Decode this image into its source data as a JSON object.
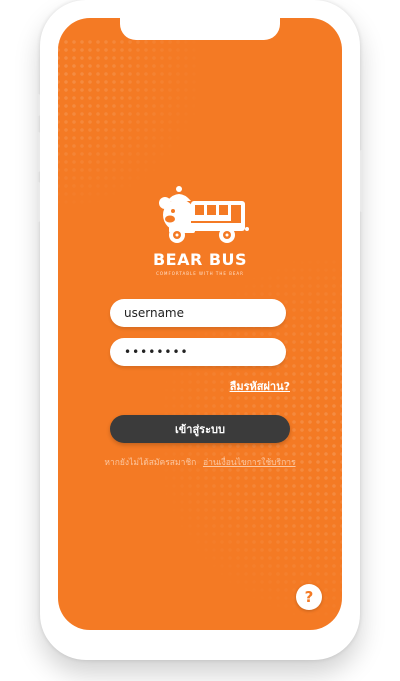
{
  "brand": {
    "name": "BEAR BUS",
    "tagline": "COMFORTABLE WITH THE BEAR"
  },
  "login": {
    "username_value": "username",
    "password_value": "••••••••",
    "forgot_label": "ลืมรหัสผ่าน?",
    "submit_label": "เข้าสู่ระบบ"
  },
  "register": {
    "prompt": "หากยังไม่ได้สมัครสมาชิก",
    "link": "อ่านเงื่อนไขการใช้บริการ"
  },
  "help": {
    "label": "?"
  },
  "colors": {
    "accent": "#f47a24",
    "button_dark": "#3b3b3b"
  },
  "icons": [
    "bear-bus-logo-icon",
    "question-icon"
  ]
}
